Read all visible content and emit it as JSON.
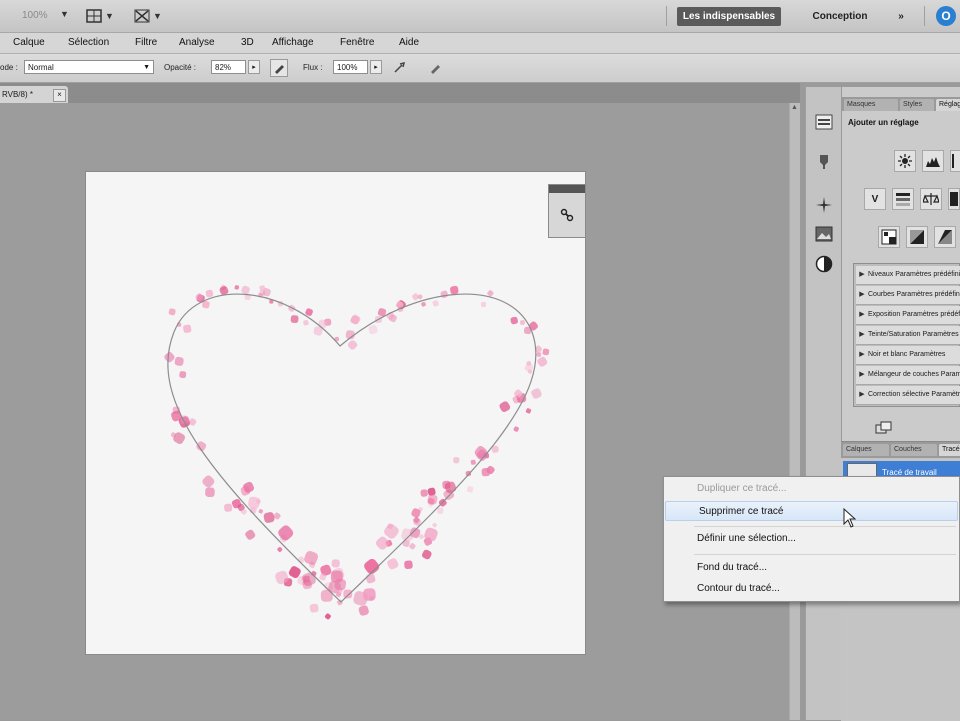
{
  "appbar": {
    "zoom_value": "100%",
    "workspace_active": "Les indispensables",
    "workspace_other": "Conception",
    "workspace_more": "»",
    "cs_live_glyph": "O"
  },
  "menubar": {
    "items": [
      "Calque",
      "Sélection",
      "Filtre",
      "Analyse",
      "3D",
      "Affichage",
      "Fenêtre",
      "Aide"
    ]
  },
  "options_bar": {
    "mode_label": "ode :",
    "mode_value": "Normal",
    "opacity_label": "Opacité :",
    "opacity_value": "82%",
    "flow_label": "Flux :",
    "flow_value": "100%"
  },
  "document_tab": {
    "label": "RVB/8) *",
    "close_glyph": "×"
  },
  "panels": {
    "top_tabs": [
      "Masques",
      "Styles",
      "Réglages"
    ],
    "adjustments_title": "Ajouter un réglage",
    "adj_row2_text_icon": "V",
    "presets": [
      "Niveaux Paramètres prédéfinis",
      "Courbes Paramètres prédéfinis",
      "Exposition Paramètres prédéfinis",
      "Teinte/Saturation Paramètres",
      "Noir et blanc Paramètres",
      "Mélangeur de couches Paramètres",
      "Correction sélective Paramètres"
    ],
    "bottom_tabs": [
      "Calques",
      "Couches",
      "Tracés"
    ],
    "path_name": "Tracé de travail"
  },
  "context_menu": {
    "items": [
      {
        "label": "Dupliquer ce tracé...",
        "state": "disabled"
      },
      {
        "label": "Supprimer ce tracé",
        "state": "hover"
      },
      {
        "label": "Définir une sélection...",
        "state": "normal"
      },
      {
        "label": "Fond du tracé...",
        "state": "normal"
      },
      {
        "label": "Contour du tracé...",
        "state": "normal"
      }
    ]
  },
  "colors": {
    "workspace_bg": "#9c9c9c",
    "canvas_bg": "#f5f5f5",
    "heart_pink": "#e86fa3",
    "selection_blue": "#3f7ed5"
  }
}
